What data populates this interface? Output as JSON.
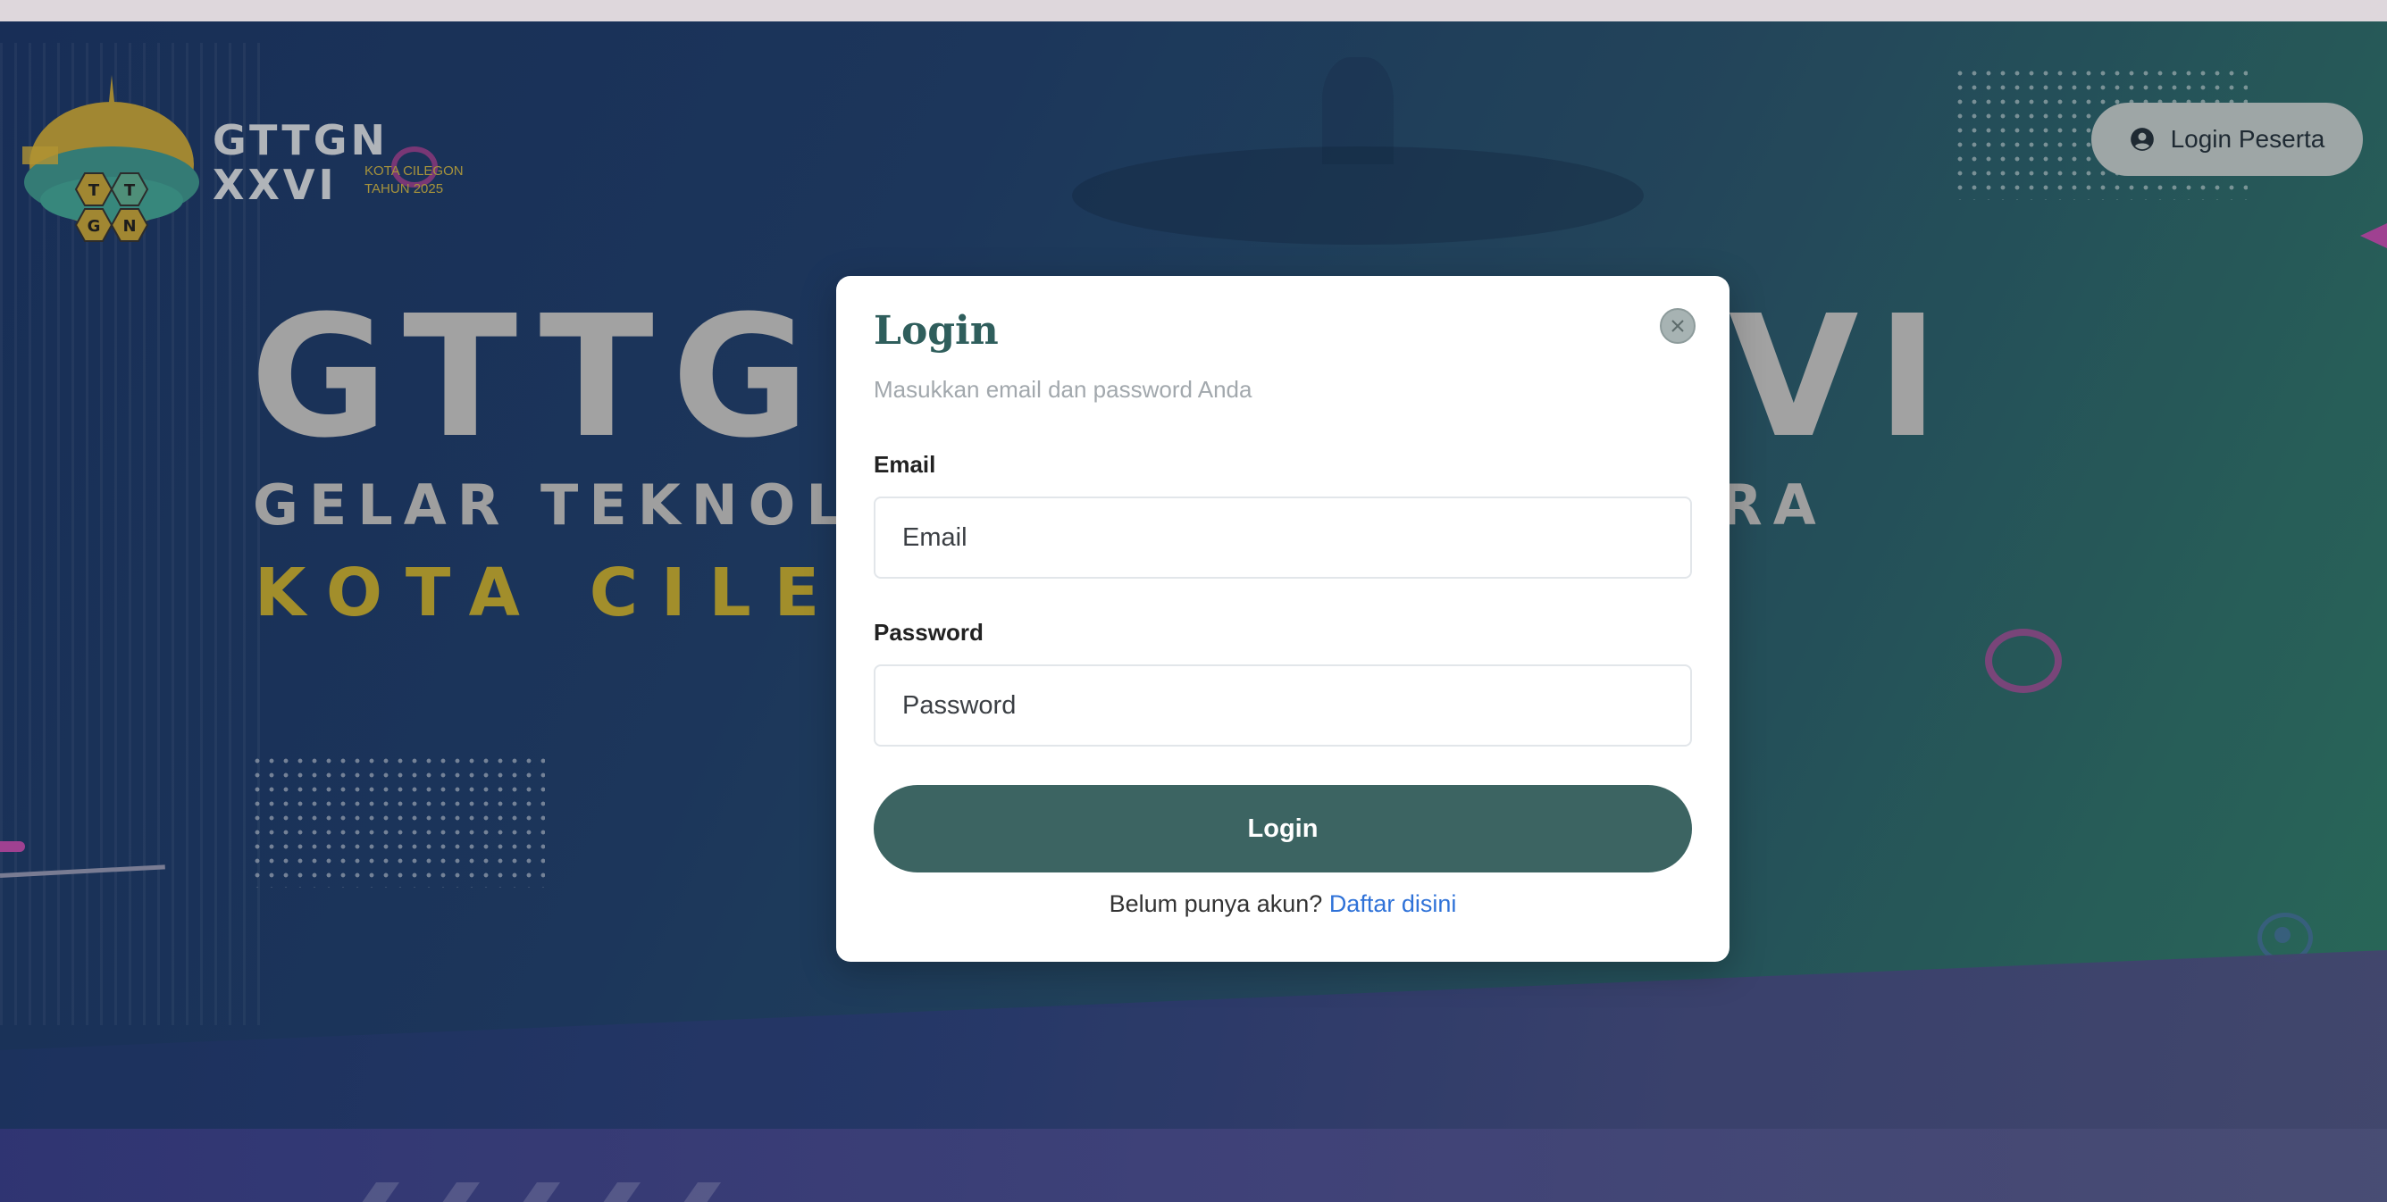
{
  "background": {
    "logo": {
      "line1": "GTTGN",
      "line2": "XXVI",
      "small1": "KOTA CILEGON",
      "small2": "TAHUN 2025"
    },
    "hero_left": "GTTG",
    "hero_right": "VI",
    "hero_sub_left": "GELAR TEKNOLO",
    "hero_sub_right": "RA",
    "hero_city": "KOTA CILE"
  },
  "header": {
    "login_peserta_label": "Login Peserta",
    "login_peserta_icon": "user-circle-icon"
  },
  "modal": {
    "title": "Login",
    "subtitle": "Masukkan email dan password Anda",
    "close_icon": "close-icon",
    "email": {
      "label": "Email",
      "placeholder": "Email",
      "value": ""
    },
    "password": {
      "label": "Password",
      "placeholder": "Password",
      "value": ""
    },
    "submit_label": "Login",
    "register_prompt": "Belum punya akun?",
    "register_link": "Daftar disini"
  },
  "colors": {
    "accent": "#3c6462",
    "title": "#2f5e5c",
    "link": "#2f72d8"
  }
}
